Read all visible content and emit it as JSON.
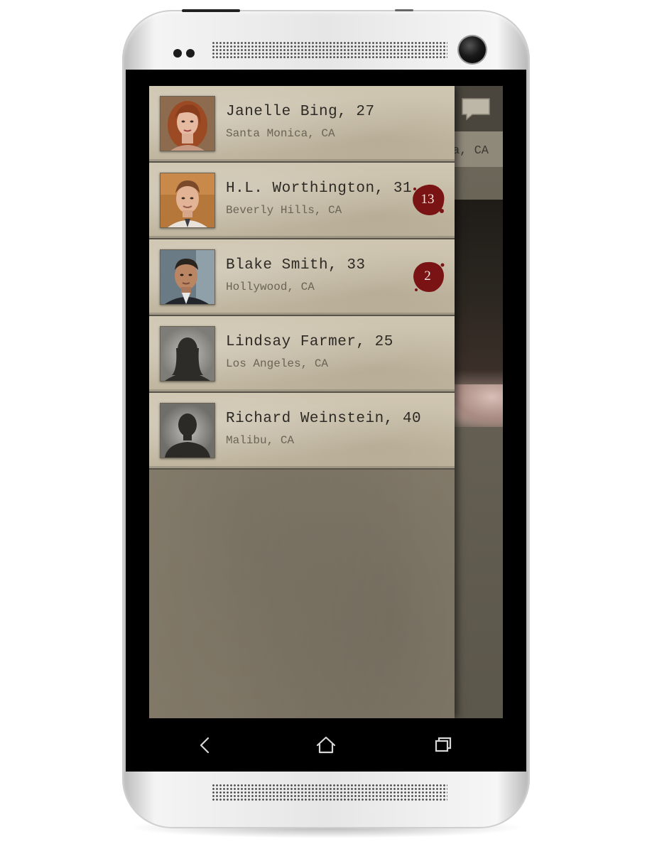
{
  "app": {
    "background_location": "a, CA",
    "icons": {
      "chat": "chat-bubble-icon",
      "back": "back-icon",
      "home": "home-icon",
      "recent": "recent-apps-icon"
    }
  },
  "contacts": [
    {
      "name": "Janelle Bing, 27",
      "location": "Santa Monica, CA",
      "badge": null,
      "avatar": "photo-female-red-hair"
    },
    {
      "name": "H.L. Worthington, 31",
      "location": "Beverly Hills, CA",
      "badge": "13",
      "avatar": "photo-male-auburn-hair"
    },
    {
      "name": "Blake Smith, 33",
      "location": "Hollywood, CA",
      "badge": "2",
      "avatar": "photo-male-dark-hair"
    },
    {
      "name": "Lindsay Farmer, 25",
      "location": "Los Angeles, CA",
      "badge": null,
      "avatar": "silhouette-female"
    },
    {
      "name": "Richard Weinstein, 40",
      "location": "Malibu, CA",
      "badge": null,
      "avatar": "silhouette-male"
    }
  ],
  "colors": {
    "badge": "#7a1414",
    "row_paper": "#c8bfaa",
    "text_name": "#2d2a25",
    "text_location": "#6b6455"
  }
}
